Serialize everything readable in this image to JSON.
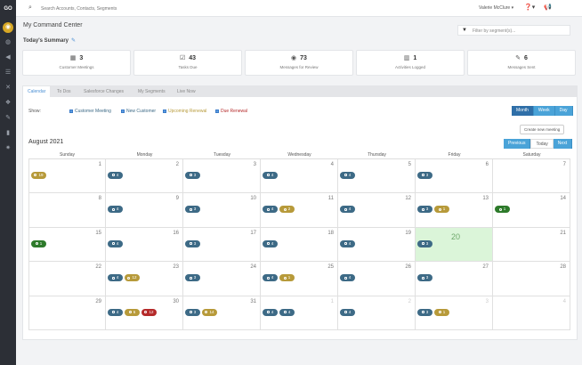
{
  "rail": {
    "logo": "GO",
    "items": [
      {
        "icon": "dashboard-icon",
        "glyph": "◉",
        "active": true
      },
      {
        "icon": "globe-icon",
        "glyph": "◍",
        "active": false
      },
      {
        "icon": "megaphone-icon",
        "glyph": "◀",
        "active": false
      },
      {
        "icon": "contacts-icon",
        "glyph": "☰",
        "active": false
      },
      {
        "icon": "swap-icon",
        "glyph": "✕",
        "active": false
      },
      {
        "icon": "tag-icon",
        "glyph": "❖",
        "active": false
      },
      {
        "icon": "wrench-icon",
        "glyph": "✎",
        "active": false
      },
      {
        "icon": "report-icon",
        "glyph": "▮",
        "active": false
      },
      {
        "icon": "settings-icon",
        "glyph": "✷",
        "active": false
      }
    ]
  },
  "topbar": {
    "search_placeholder": "Search Accounts, Contacts, Segments",
    "user": "Valerie McClure ▾",
    "help": "❓▾",
    "announce": "📢"
  },
  "page": {
    "title": "My Command Center",
    "summary_title": "Today's Summary",
    "filter_placeholder": "Filter by segment(s)..."
  },
  "summary_cards": [
    {
      "icon": "▦",
      "icon_name": "calendar-icon",
      "value": "3",
      "label": "Customer Meetings"
    },
    {
      "icon": "☑",
      "icon_name": "checkbox-icon",
      "value": "43",
      "label": "Tasks Due"
    },
    {
      "icon": "◉",
      "icon_name": "eye-icon",
      "value": "73",
      "label": "Messages for Review"
    },
    {
      "icon": "▥",
      "icon_name": "activity-icon",
      "value": "1",
      "label": "Activities Logged"
    },
    {
      "icon": "✎",
      "icon_name": "compose-icon",
      "value": "6",
      "label": "Messages Sent"
    }
  ],
  "tabs": [
    {
      "label": "Calendar",
      "active": true
    },
    {
      "label": "To Dos",
      "active": false
    },
    {
      "label": "Salesforce Changes",
      "active": false
    },
    {
      "label": "My Segments",
      "active": false
    },
    {
      "label": "Live Now",
      "active": false
    }
  ],
  "legend": {
    "show_label": "Show:",
    "items": [
      {
        "label": "Customer Meeting",
        "color": "#3d6a86"
      },
      {
        "label": "New Customer",
        "color": "#3d6a86"
      },
      {
        "label": "Upcoming Renewal",
        "color": "#b79a3a"
      },
      {
        "label": "Due Renewal",
        "color": "#b52a2a"
      }
    ]
  },
  "view_buttons": [
    {
      "label": "Month",
      "active": true
    },
    {
      "label": "Week",
      "active": false
    },
    {
      "label": "Day",
      "active": false
    }
  ],
  "create_label": "Create new meeting",
  "nav_buttons": [
    {
      "label": "Previous",
      "kind": "blue"
    },
    {
      "label": "Today",
      "kind": "plain"
    },
    {
      "label": "Next",
      "kind": "blue"
    }
  ],
  "calendar": {
    "month_label": "August 2021",
    "days_of_week": [
      "Sunday",
      "Monday",
      "Tuesday",
      "Wednesday",
      "Thursday",
      "Friday",
      "Saturday"
    ],
    "weeks": [
      [
        {
          "day": "1",
          "badges": [
            {
              "type": "gold",
              "text": "19"
            }
          ]
        },
        {
          "day": "2",
          "badges": [
            {
              "type": "meet",
              "text": "4"
            }
          ]
        },
        {
          "day": "3",
          "badges": [
            {
              "type": "meet",
              "text": "3"
            }
          ]
        },
        {
          "day": "4",
          "badges": [
            {
              "type": "meet",
              "text": "4"
            }
          ]
        },
        {
          "day": "5",
          "badges": [
            {
              "type": "meet",
              "text": "4"
            }
          ]
        },
        {
          "day": "6",
          "badges": [
            {
              "type": "meet",
              "text": "3"
            }
          ]
        },
        {
          "day": "7",
          "badges": []
        }
      ],
      [
        {
          "day": "8",
          "badges": []
        },
        {
          "day": "9",
          "badges": [
            {
              "type": "meet",
              "text": "4"
            }
          ]
        },
        {
          "day": "10",
          "badges": [
            {
              "type": "meet",
              "text": "3"
            }
          ]
        },
        {
          "day": "11",
          "badges": [
            {
              "type": "meet",
              "text": "4"
            },
            {
              "type": "gold",
              "text": "2"
            }
          ]
        },
        {
          "day": "12",
          "badges": [
            {
              "type": "meet",
              "text": "4"
            }
          ]
        },
        {
          "day": "13",
          "badges": [
            {
              "type": "meet",
              "text": "3"
            },
            {
              "type": "gold",
              "text": "1"
            }
          ]
        },
        {
          "day": "14",
          "badges": [
            {
              "type": "green",
              "text": "1"
            }
          ]
        }
      ],
      [
        {
          "day": "15",
          "badges": [
            {
              "type": "green",
              "text": "1"
            }
          ]
        },
        {
          "day": "16",
          "badges": [
            {
              "type": "meet",
              "text": "4"
            }
          ]
        },
        {
          "day": "17",
          "badges": [
            {
              "type": "meet",
              "text": "3"
            }
          ]
        },
        {
          "day": "18",
          "badges": [
            {
              "type": "meet",
              "text": "4"
            }
          ]
        },
        {
          "day": "19",
          "badges": [
            {
              "type": "meet",
              "text": "4"
            }
          ]
        },
        {
          "day": "20",
          "badges": [
            {
              "type": "meet",
              "text": "3"
            }
          ],
          "today": true
        },
        {
          "day": "21",
          "badges": []
        }
      ],
      [
        {
          "day": "22",
          "badges": []
        },
        {
          "day": "23",
          "badges": [
            {
              "type": "meet",
              "text": "4"
            },
            {
              "type": "gold",
              "text": "12"
            }
          ]
        },
        {
          "day": "24",
          "badges": [
            {
              "type": "meet",
              "text": "3"
            }
          ]
        },
        {
          "day": "25",
          "badges": [
            {
              "type": "meet",
              "text": "4"
            },
            {
              "type": "gold",
              "text": "1"
            }
          ]
        },
        {
          "day": "26",
          "badges": [
            {
              "type": "meet",
              "text": "4"
            }
          ]
        },
        {
          "day": "27",
          "badges": [
            {
              "type": "meet",
              "text": "3"
            }
          ]
        },
        {
          "day": "28",
          "badges": []
        }
      ],
      [
        {
          "day": "29",
          "badges": []
        },
        {
          "day": "30",
          "badges": [
            {
              "type": "meet",
              "text": "4"
            },
            {
              "type": "gold",
              "text": "6"
            },
            {
              "type": "red",
              "text": "12"
            }
          ]
        },
        {
          "day": "31",
          "badges": [
            {
              "type": "meet",
              "text": "3"
            },
            {
              "type": "gold",
              "text": "14"
            }
          ]
        },
        {
          "day": "1",
          "badges": [
            {
              "type": "meet",
              "text": "4"
            },
            {
              "type": "meet",
              "text": "4"
            }
          ],
          "other": true
        },
        {
          "day": "2",
          "badges": [
            {
              "type": "meet",
              "text": "4"
            }
          ],
          "other": true
        },
        {
          "day": "3",
          "badges": [
            {
              "type": "meet",
              "text": "3"
            },
            {
              "type": "gold",
              "text": "1"
            }
          ],
          "other": true
        },
        {
          "day": "4",
          "badges": [],
          "other": true
        }
      ]
    ]
  }
}
